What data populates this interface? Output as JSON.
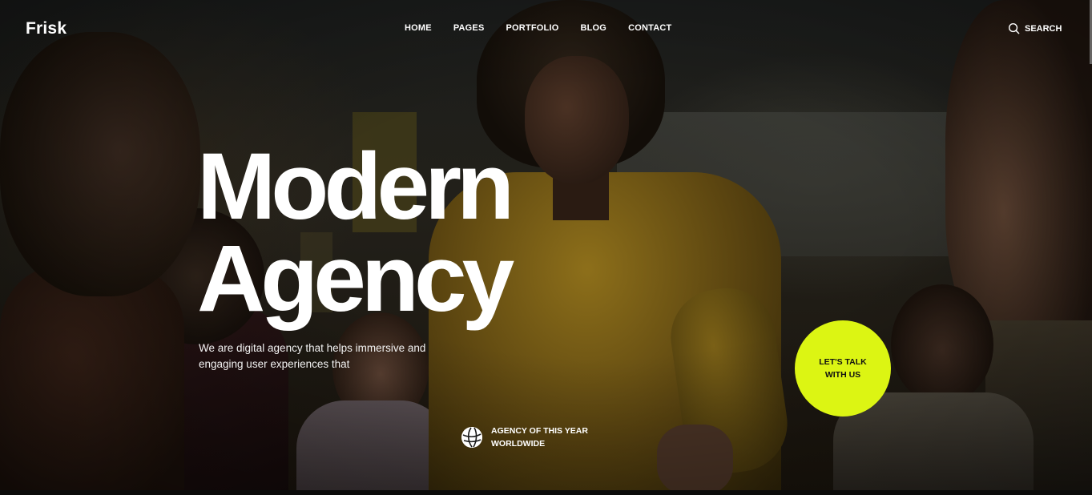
{
  "header": {
    "logo": "Frisk",
    "nav": [
      "HOME",
      "PAGES",
      "PORTFOLIO",
      "BLOG",
      "CONTACT"
    ],
    "search_label": "SEARCH"
  },
  "hero": {
    "headline_line1": "Modern",
    "headline_line2": "Agency",
    "subtext": "We are digital agency that helps immersive and engaging user experiences that",
    "cta_line1": "LET'S TALK",
    "cta_line2": "WITH US",
    "cta_color": "#dcf513",
    "award_line1": "AGENCY OF THIS YEAR",
    "award_line2": "WORLDWIDE",
    "award_icon": "globe-icon"
  }
}
